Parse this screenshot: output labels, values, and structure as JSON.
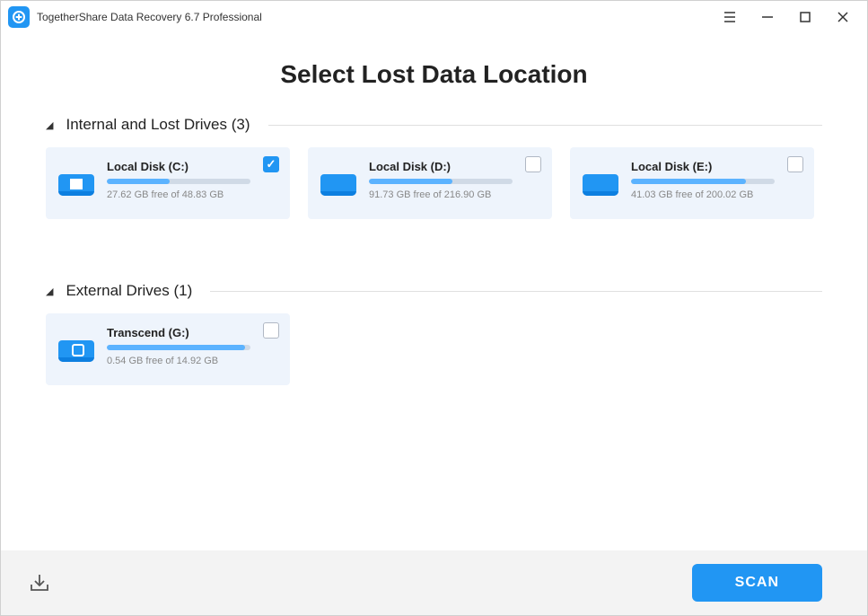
{
  "titlebar": {
    "app_title": "TogetherShare Data Recovery 6.7 Professional"
  },
  "page_title": "Select Lost Data Location",
  "sections": {
    "internal": {
      "label": "Internal and Lost Drives (3)",
      "drives": [
        {
          "name": "Local Disk (C:)",
          "space": "27.62 GB free of 48.83 GB",
          "fill_pct": 44,
          "checked": true,
          "icon_type": "win"
        },
        {
          "name": "Local Disk (D:)",
          "space": "91.73 GB free of 216.90 GB",
          "fill_pct": 58,
          "checked": false,
          "icon_type": "plain"
        },
        {
          "name": "Local Disk (E:)",
          "space": "41.03 GB free of 200.02 GB",
          "fill_pct": 80,
          "checked": false,
          "icon_type": "plain"
        }
      ]
    },
    "external": {
      "label": "External Drives (1)",
      "drives": [
        {
          "name": "Transcend (G:)",
          "space": "0.54 GB free of 14.92 GB",
          "fill_pct": 96,
          "checked": false,
          "icon_type": "usb"
        }
      ]
    }
  },
  "footer": {
    "scan_label": "SCAN"
  }
}
